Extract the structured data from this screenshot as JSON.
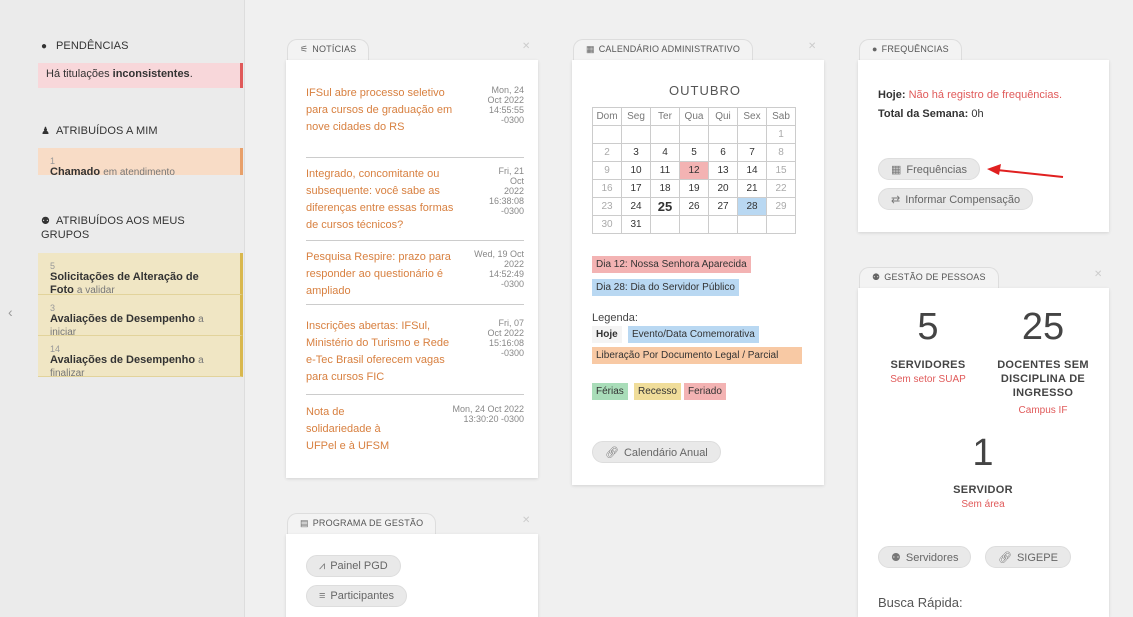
{
  "sidebar": {
    "pendencias_title": "PENDÊNCIAS",
    "alert_text_pre": "Há titulações ",
    "alert_text_bold": "inconsistentes",
    "alert_text_post": ".",
    "atribuidos_title": "ATRIBUÍDOS A MIM",
    "chamado": {
      "count": "1",
      "label": "Chamado",
      "status": "em atendimento"
    },
    "grupos_title_line1": "ATRIBUÍDOS AOS MEUS",
    "grupos_title_line2": "GRUPOS",
    "group_items": [
      {
        "count": "5",
        "label": "Solicitações de Alteração de Foto",
        "status": "a validar"
      },
      {
        "count": "3",
        "label": "Avaliações de Desempenho",
        "status": "a iniciar"
      },
      {
        "count": "14",
        "label": "Avaliações de Desempenho",
        "status": "a finalizar"
      }
    ]
  },
  "noticias": {
    "tab": "NOTÍCIAS",
    "items": [
      {
        "title": "IFSul abre processo seletivo para cursos de graduação em nove cidades do RS",
        "date": "Mon, 24\nOct 2022\n14:55:55\n-0300"
      },
      {
        "title": "Integrado, concomitante ou subsequente: você sabe as diferenças entre essas formas de cursos técnicos?",
        "date": "Fri, 21\nOct\n2022\n16:38:08\n-0300"
      },
      {
        "title": "Pesquisa Respire: prazo para responder ao questionário é ampliado",
        "date": "Wed, 19 Oct\n2022\n14:52:49\n-0300"
      },
      {
        "title": "Inscrições abertas: IFSul, Ministério do Turismo e Rede e-Tec Brasil oferecem vagas para cursos FIC",
        "date": "Fri, 07\nOct 2022\n15:16:08\n-0300"
      },
      {
        "title": "Nota de solidariedade à UFPel e à UFSM",
        "date": "Mon, 24 Oct 2022\n13:30:20 -0300"
      }
    ]
  },
  "calendario": {
    "tab": "CALENDÁRIO ADMINISTRATIVO",
    "month": "OUTUBRO",
    "weekdays": [
      "Dom",
      "Seg",
      "Ter",
      "Qua",
      "Qui",
      "Sex",
      "Sab"
    ],
    "weeks": [
      [
        "",
        "",
        "",
        "",
        "",
        "",
        "1"
      ],
      [
        "2",
        "3",
        "4",
        "5",
        "6",
        "7",
        "8"
      ],
      [
        "9",
        "10",
        "11",
        "12",
        "13",
        "14",
        "15"
      ],
      [
        "16",
        "17",
        "18",
        "19",
        "20",
        "21",
        "22"
      ],
      [
        "23",
        "24",
        "25",
        "26",
        "27",
        "28",
        "29"
      ],
      [
        "30",
        "31",
        "",
        "",
        "",
        "",
        ""
      ]
    ],
    "holiday_day": "12",
    "event_day": "28",
    "today_day": "25",
    "events": [
      "Dia 12: Nossa Senhora Aparecida",
      "Dia 28: Dia do Servidor Público"
    ],
    "legend_label": "Legenda:",
    "legend_today": "Hoje",
    "legend_event": "Evento/Data Comemorativa",
    "legend_liberacao": "Liberação Por Documento Legal / Parcial",
    "legend_ferias": "Férias",
    "legend_recesso": "Recesso",
    "legend_feriado": "Feriado",
    "annual_button": "Calendário Anual"
  },
  "frequencias": {
    "tab": "FREQUÊNCIAS",
    "hoje_label": "Hoje:",
    "hoje_value": "Não há registro de frequências.",
    "semana_label": "Total da Semana:",
    "semana_value": "0h",
    "frequencias_button": "Frequências",
    "compensacao_button": "Informar Compensação"
  },
  "gestao": {
    "tab": "GESTÃO DE PESSOAS",
    "stat1_num": "5",
    "stat1_label": "SERVIDORES",
    "stat1_sub": "Sem setor SUAP",
    "stat2_num": "25",
    "stat2_label": "DOCENTES SEM DISCIPLINA DE INGRESSO",
    "stat2_sub": "Campus IF",
    "stat3_num": "1",
    "stat3_label": "SERVIDOR",
    "stat3_sub": "Sem área",
    "servidores_button": "Servidores",
    "sigepe_button": "SIGEPE",
    "busca_label": "Busca Rápida:"
  },
  "programa": {
    "tab": "PROGRAMA DE GESTÃO",
    "painel_button": "Painel PGD",
    "participantes_button": "Participantes"
  },
  "colors": {
    "accent_orange": "#d88040",
    "alert_red": "#e05a5a",
    "arrow": "#e02020"
  }
}
